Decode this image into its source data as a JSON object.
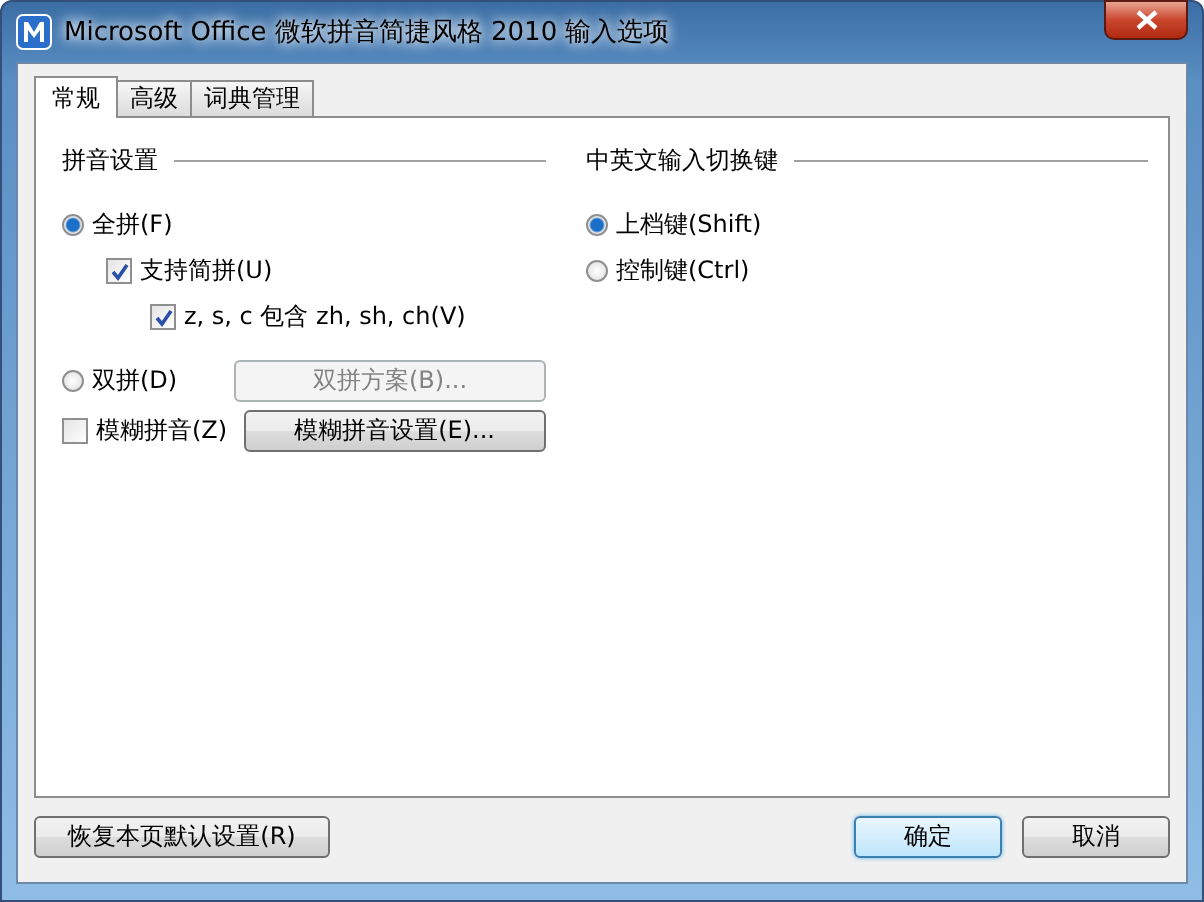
{
  "window": {
    "title": "Microsoft Office 微软拼音简捷风格 2010 输入选项"
  },
  "tabs": [
    {
      "label": "常规",
      "selected": true
    },
    {
      "label": "高级",
      "selected": false
    },
    {
      "label": "词典管理",
      "selected": false
    }
  ],
  "groups": [
    {
      "title": "拼音设置",
      "options": [
        {
          "kind": "radio",
          "label": "全拼(F)",
          "selected": true,
          "children": [
            {
              "kind": "checkbox",
              "label": "支持简拼(U)",
              "checked": true,
              "children": [
                {
                  "kind": "checkbox",
                  "label": "z, s, c 包含 zh, sh, ch(V)",
                  "checked": true
                }
              ]
            }
          ]
        },
        {
          "kind": "radio",
          "label": "双拼(D)",
          "selected": false,
          "button": {
            "label": "双拼方案(B)...",
            "disabled": true
          }
        },
        {
          "kind": "checkbox",
          "label": "模糊拼音(Z)",
          "checked": false,
          "button": {
            "label": "模糊拼音设置(E)...",
            "disabled": false
          }
        }
      ]
    },
    {
      "title": "中英文输入切换键",
      "options": [
        {
          "kind": "radio",
          "label": "上档键(Shift)",
          "selected": true
        },
        {
          "kind": "radio",
          "label": "控制键(Ctrl)",
          "selected": false
        }
      ]
    }
  ],
  "footer": {
    "left_buttons": [
      {
        "label": "恢复本页默认设置(R)",
        "default": false
      }
    ],
    "right_buttons": [
      {
        "label": "确定",
        "default": true
      },
      {
        "label": "取消",
        "default": false
      }
    ]
  }
}
